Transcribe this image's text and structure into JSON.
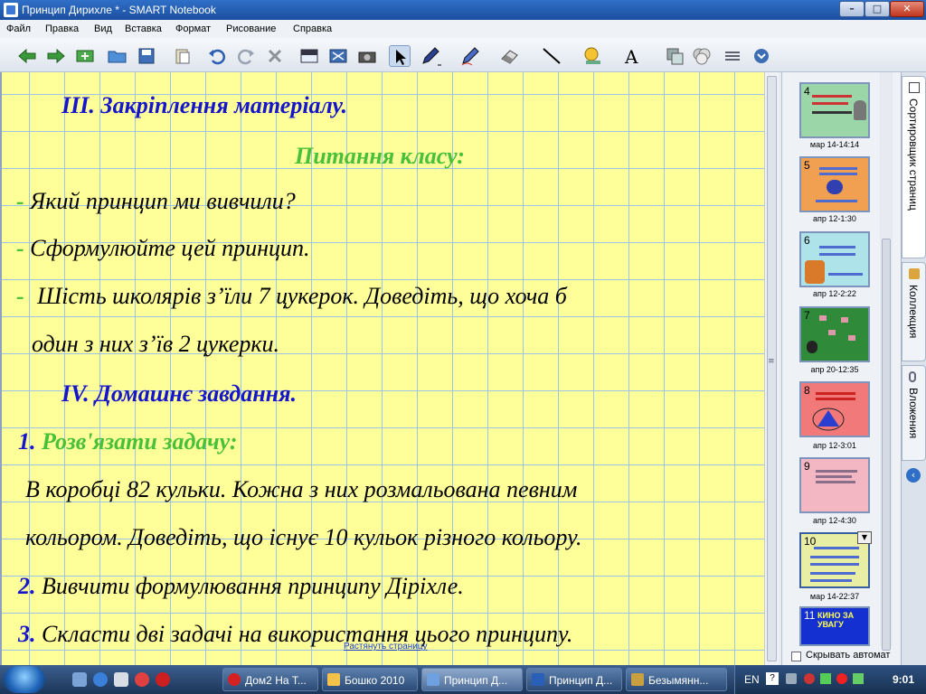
{
  "window": {
    "title": "Принцип Дирихле * - SMART Notebook",
    "minimize_glyph": "–",
    "maximize_glyph": "□",
    "close_glyph": "✕"
  },
  "menu": [
    "Файл",
    "Правка",
    "Вид",
    "Вставка",
    "Формат",
    "Рисование",
    "Справка"
  ],
  "toolbar": [
    "back-arrow-icon",
    "forward-arrow-icon",
    "add-page-icon",
    "open-folder-icon",
    "save-icon",
    "paste-icon",
    "undo-icon",
    "redo-icon",
    "delete-icon",
    "screen-shade-icon",
    "full-screen-icon",
    "camera-icon",
    "select-pointer-icon",
    "pen-icon",
    "creative-pen-icon",
    "eraser-icon",
    "line-icon",
    "fill-icon",
    "text-icon",
    "properties-icon",
    "table-icon",
    "move-toolbar-icon",
    "more-icon"
  ],
  "slide": {
    "heading3": "III. Закріплення матеріалу.",
    "subheading": "Питання класу:",
    "dash": "-",
    "q1": "Який принцип ми вивчили?",
    "q2": "Сформулюйте цей принцип.",
    "q3a": "Шість школярів з’їли 7 цукерок. Доведіть, що хоча б",
    "q3b": "один з них з’їв 2 цукерки.",
    "heading4": "IV. Домашнє завдання.",
    "n1": "1.",
    "task1_title": "Розв'язати задачу:",
    "task1_line1": "В коробці 82 кульки. Кожна з них розмальована певним",
    "task1_line2": "кольором. Доведіть, що існує 10 кульок різного кольору.",
    "n2": "2.",
    "task2": "Вивчити формулювання принципу Діріхле.",
    "n3": "3.",
    "task3": "Скласти дві задачі на використання цього принципу.",
    "resize_link": "Растянуть страницу"
  },
  "pages": [
    {
      "num": "4",
      "label": "мар 14-14:14",
      "color": "#9ad6a8"
    },
    {
      "num": "5",
      "label": "апр 12-1:30",
      "color": "#f0a050"
    },
    {
      "num": "6",
      "label": "апр 12-2:22",
      "color": "#aee3ea"
    },
    {
      "num": "7",
      "label": "апр 20-12:35",
      "color": "#2f8a3a"
    },
    {
      "num": "8",
      "label": "апр 12-3:01",
      "color": "#f2797a"
    },
    {
      "num": "9",
      "label": "апр 12-4:30",
      "color": "#f3b7c3"
    },
    {
      "num": "10",
      "label": "мар 14-22:37",
      "color": "#e8efa5"
    },
    {
      "num": "11",
      "label": "",
      "color": "#1530d0"
    }
  ],
  "thumb11_text": "КИНО ЗА УВАГУ",
  "autohide": "Скрывать автомат",
  "side_tabs": [
    "Сортировщик страниц",
    "Коллекция",
    "Вложения"
  ],
  "taskbar": {
    "tasks": [
      {
        "label": "Дом2 На Т...",
        "color": "#d42020"
      },
      {
        "label": "Бошко 2010",
        "color": "#f2c24a"
      },
      {
        "label": "Принцип Д...",
        "color": "#6fa0e0"
      },
      {
        "label": "Принцип Д...",
        "color": "#2a5fb8"
      },
      {
        "label": "Безымянн...",
        "color": "#c8a040"
      }
    ],
    "lang": "EN",
    "clock": "9:01"
  }
}
